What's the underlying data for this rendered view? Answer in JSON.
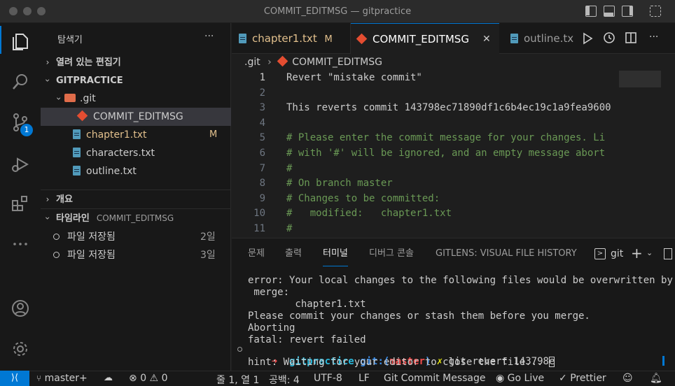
{
  "window": {
    "title": "COMMIT_EDITMSG — gitpractice"
  },
  "activity": {
    "scm_badge": "1"
  },
  "sidebar": {
    "header": "탐색기",
    "more": "···",
    "open_editors": "열려 있는 편집기",
    "workspace": "GITPRACTICE",
    "tree": {
      "git_folder": ".git",
      "commit_file": "COMMIT_EDITMSG",
      "files": [
        {
          "name": "chapter1.txt",
          "badge": "M"
        },
        {
          "name": "characters.txt",
          "badge": ""
        },
        {
          "name": "outline.txt",
          "badge": ""
        }
      ]
    },
    "outline": "개요",
    "timeline": {
      "label": "타임라인",
      "context": "COMMIT_EDITMSG"
    },
    "timeline_items": [
      {
        "label": "파일 저장됨",
        "age": "2일"
      },
      {
        "label": "파일 저장됨",
        "age": "3일"
      }
    ]
  },
  "tabs": [
    {
      "label": "chapter1.txt",
      "badge": "M"
    },
    {
      "label": "COMMIT_EDITMSG",
      "close": "✕"
    },
    {
      "label": "outline.tx"
    }
  ],
  "breadcrumb": {
    "folder": ".git",
    "sep": "›",
    "file": "COMMIT_EDITMSG"
  },
  "code_lines": [
    {
      "n": "1",
      "text": "Revert \"mistake commit\""
    },
    {
      "n": "2",
      "text": ""
    },
    {
      "n": "3",
      "text": "This reverts commit 143798ec71890df1c6b4ec19c1a9fea9600"
    },
    {
      "n": "4",
      "text": ""
    },
    {
      "n": "5",
      "text": "# Please enter the commit message for your changes. Li"
    },
    {
      "n": "6",
      "text": "# with '#' will be ignored, and an empty message abort"
    },
    {
      "n": "7",
      "text": "#"
    },
    {
      "n": "8",
      "text": "# On branch master"
    },
    {
      "n": "9",
      "text": "# Changes to be committed:"
    },
    {
      "n": "10",
      "text": "#   modified:   chapter1.txt"
    },
    {
      "n": "11",
      "text": "#"
    }
  ],
  "panel": {
    "tabs": [
      "문제",
      "출력",
      "터미널",
      "디버그 콘솔",
      "GITLENS: VISUAL FILE HISTORY"
    ],
    "terminal_name": "git",
    "terminal_lines": [
      "error: Your local changes to the following files would be overwritten by",
      " merge:",
      "        chapter1.txt",
      "Please commit your changes or stash them before you merge.",
      "Aborting",
      "fatal: revert failed"
    ],
    "prompt": {
      "arrow": "➜",
      "dir": "gitpractice",
      "git": "git:(",
      "branch": "master",
      "close": ")",
      "mark": "✗",
      "cmd": "git revert 143798e"
    },
    "hint": "hint: Waiting for your editor to close the file... "
  },
  "status": {
    "branch": "master+",
    "errors": "0",
    "warnings": "0",
    "position": "줄 1, 열 1",
    "spaces": "공백: 4",
    "encoding": "UTF-8",
    "eol": "LF",
    "language": "Git Commit Message",
    "golive": "Go Live",
    "prettier": "Prettier"
  },
  "colors": {
    "accent": "#0078d4",
    "modified": "#e2c08d",
    "git_orange": "#e44d31",
    "prompt_green": "#23d18b",
    "prompt_cyan": "#29b8db"
  }
}
